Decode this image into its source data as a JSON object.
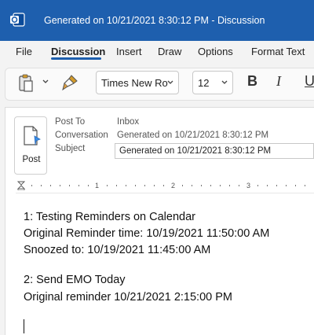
{
  "window": {
    "title": "Generated on 10/21/2021 8:30:12 PM  -  Discussion"
  },
  "menu": {
    "file": "File",
    "discussion": "Discussion",
    "insert": "Insert",
    "draw": "Draw",
    "options": "Options",
    "format_text": "Format Text"
  },
  "ribbon": {
    "font_name": "Times New Ro",
    "font_size": "12",
    "bold": "B",
    "italic": "I",
    "underline": "U"
  },
  "header": {
    "post_button": "Post",
    "post_to_label": "Post To",
    "post_to_value": "Inbox",
    "conversation_label": "Conversation",
    "conversation_value": "Generated on 10/21/2021 8:30:12 PM",
    "subject_label": "Subject",
    "subject_value": "Generated on 10/21/2021 8:30:12 PM"
  },
  "ruler": {
    "marks": [
      "1",
      "2",
      "3"
    ]
  },
  "body": {
    "lines": [
      "1: Testing Reminders on Calendar",
      "Original Reminder time: 10/19/2021 11:50:00 AM",
      "Snoozed to: 10/19/2021 11:45:00 AM",
      "2: Send EMO Today",
      "Original reminder 10/21/2021 2:15:00 PM"
    ]
  },
  "colors": {
    "accent": "#1e5fae",
    "titlebar_text": "#ffffff",
    "post_pin": "#3a8ee6"
  },
  "icons": [
    "outlook-app-icon",
    "paste-icon",
    "format-painter-icon",
    "post-icon"
  ]
}
